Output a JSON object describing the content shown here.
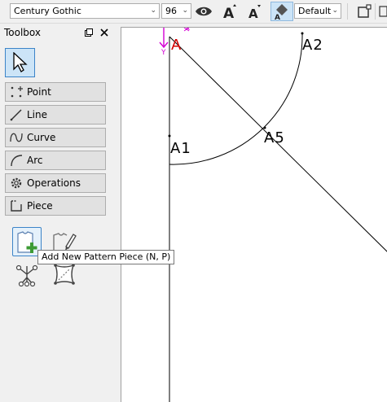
{
  "toolbar": {
    "font_name": "Century Gothic",
    "font_size": "96",
    "pen_style": "Default"
  },
  "toolbox": {
    "title": "Toolbox",
    "groups": [
      {
        "label": "Point"
      },
      {
        "label": "Line"
      },
      {
        "label": "Curve"
      },
      {
        "label": "Arc"
      },
      {
        "label": "Operations"
      },
      {
        "label": "Piece"
      }
    ]
  },
  "tooltip": {
    "text": "Add New Pattern Piece (N, P)"
  },
  "canvas": {
    "origin_label": "A",
    "axis_x": "X",
    "axis_y": "Y",
    "points": [
      {
        "label": "A2"
      },
      {
        "label": "A1"
      },
      {
        "label": "A5"
      }
    ]
  },
  "colors": {
    "accent": "#cce4f7",
    "origin": "#d40000",
    "axis": "#d400d4"
  }
}
